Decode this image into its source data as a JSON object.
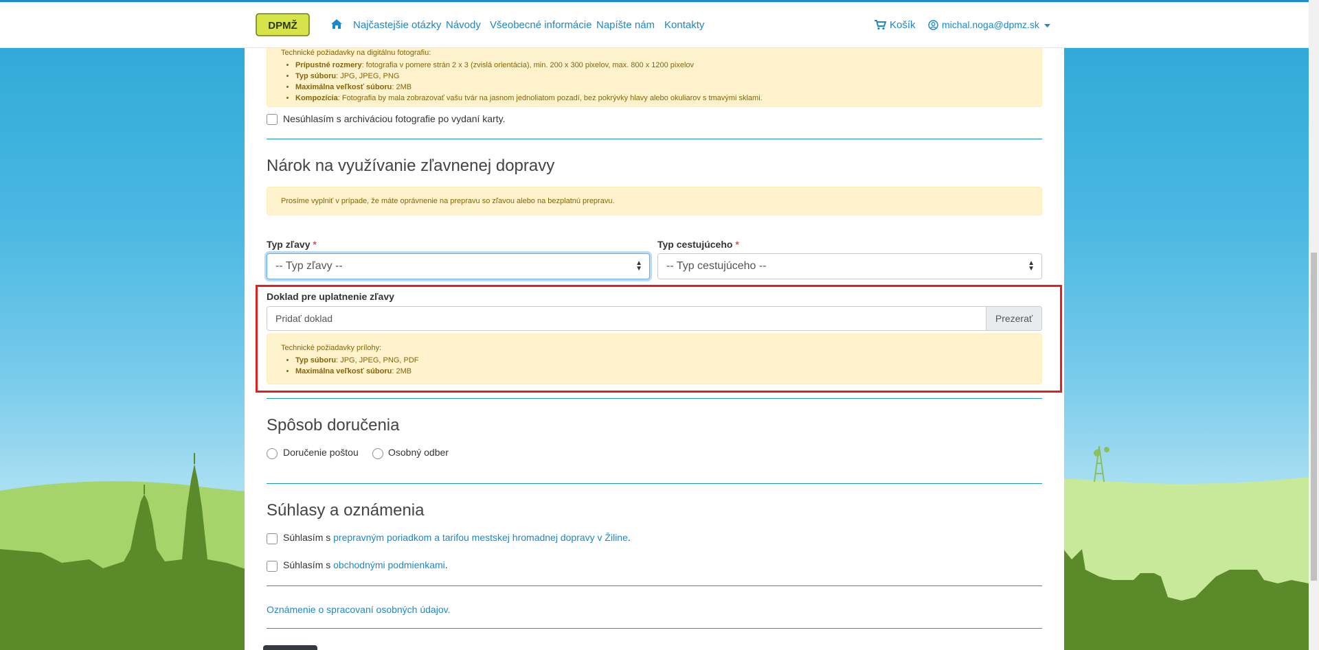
{
  "header": {
    "nav": [
      "Najčastejšie otázky",
      "Návody",
      "Všeobecné informácie",
      "Napíšte nám",
      "Kontakty"
    ],
    "cart_label": "Košík",
    "user_email": "michal.noga@dpmz.sk",
    "logo_text": "DPMŽ",
    "icons": {
      "home": "home-icon",
      "cart": "cart-icon",
      "user": "user-circle-icon",
      "caret": "caret-down-icon"
    }
  },
  "photo_section": {
    "requirements_heading": "Technické požiadavky na digitálnu fotografiu:",
    "requirements": [
      {
        "term": "Prípustné rozmery",
        "text": ": fotografia v pomere strán 2 x 3 (zvislá orientácia), min. 200 x 300 pixelov, max. 800 x 1200 pixelov"
      },
      {
        "term": "Typ súboru",
        "text": ": JPG, JPEG, PNG"
      },
      {
        "term": "Maximálna veľkosť súboru",
        "text": ": 2MB"
      },
      {
        "term": "Kompozícia",
        "text": ": Fotografia by mala zobrazovať vašu tvár na jasnom jednoliatom pozadí, bez pokrývky hlavy alebo okuliarov s tmavými sklami."
      }
    ],
    "archive_checkbox_label": "Nesúhlasím s archiváciou fotografie po vydaní karty."
  },
  "discount_section": {
    "title": "Nárok na využívanie zľavnenej dopravy",
    "info": "Prosíme vyplniť v prípade, že máte oprávnenie na prepravu so zľavou alebo na bezplatnú prepravu.",
    "discount_type_label": "Typ zľavy",
    "discount_type_value": "-- Typ zľavy --",
    "passenger_type_label": "Typ cestujúceho",
    "passenger_type_value": "-- Typ cestujúceho --",
    "required_mark": "*",
    "document_label": "Doklad pre uplatnenie zľavy",
    "document_placeholder": "Pridať doklad",
    "browse_label": "Prezerať",
    "attachment_heading": "Technické požiadavky prílohy:",
    "attachment_requirements": [
      {
        "term": "Typ súboru",
        "text": ": JPG, JPEG, PNG, PDF"
      },
      {
        "term": "Maximálna veľkosť súboru",
        "text": ": 2MB"
      }
    ]
  },
  "delivery_section": {
    "title": "Spôsob doručenia",
    "options": [
      "Doručenie poštou",
      "Osobný odber"
    ]
  },
  "consent_section": {
    "title": "Súhlasy a oznámenia",
    "consent1_prefix": "Súhlasím s ",
    "consent1_link": "prepravným poriadkom a tarifou mestskej hromadnej dopravy v Žiline",
    "consent1_suffix": ".",
    "consent2_prefix": "Súhlasím s ",
    "consent2_link": "obchodnými podmienkami",
    "consent2_suffix": ".",
    "privacy_link": "Oznámenie o spracovaní osobných údajov."
  },
  "colors": {
    "accent": "#1c87c9",
    "alert_bg": "#fff3cd",
    "alert_text": "#856404",
    "highlight": "#e01f1f",
    "hill_dark": "#5a8a2a",
    "hill_light": "#a6d46a"
  }
}
